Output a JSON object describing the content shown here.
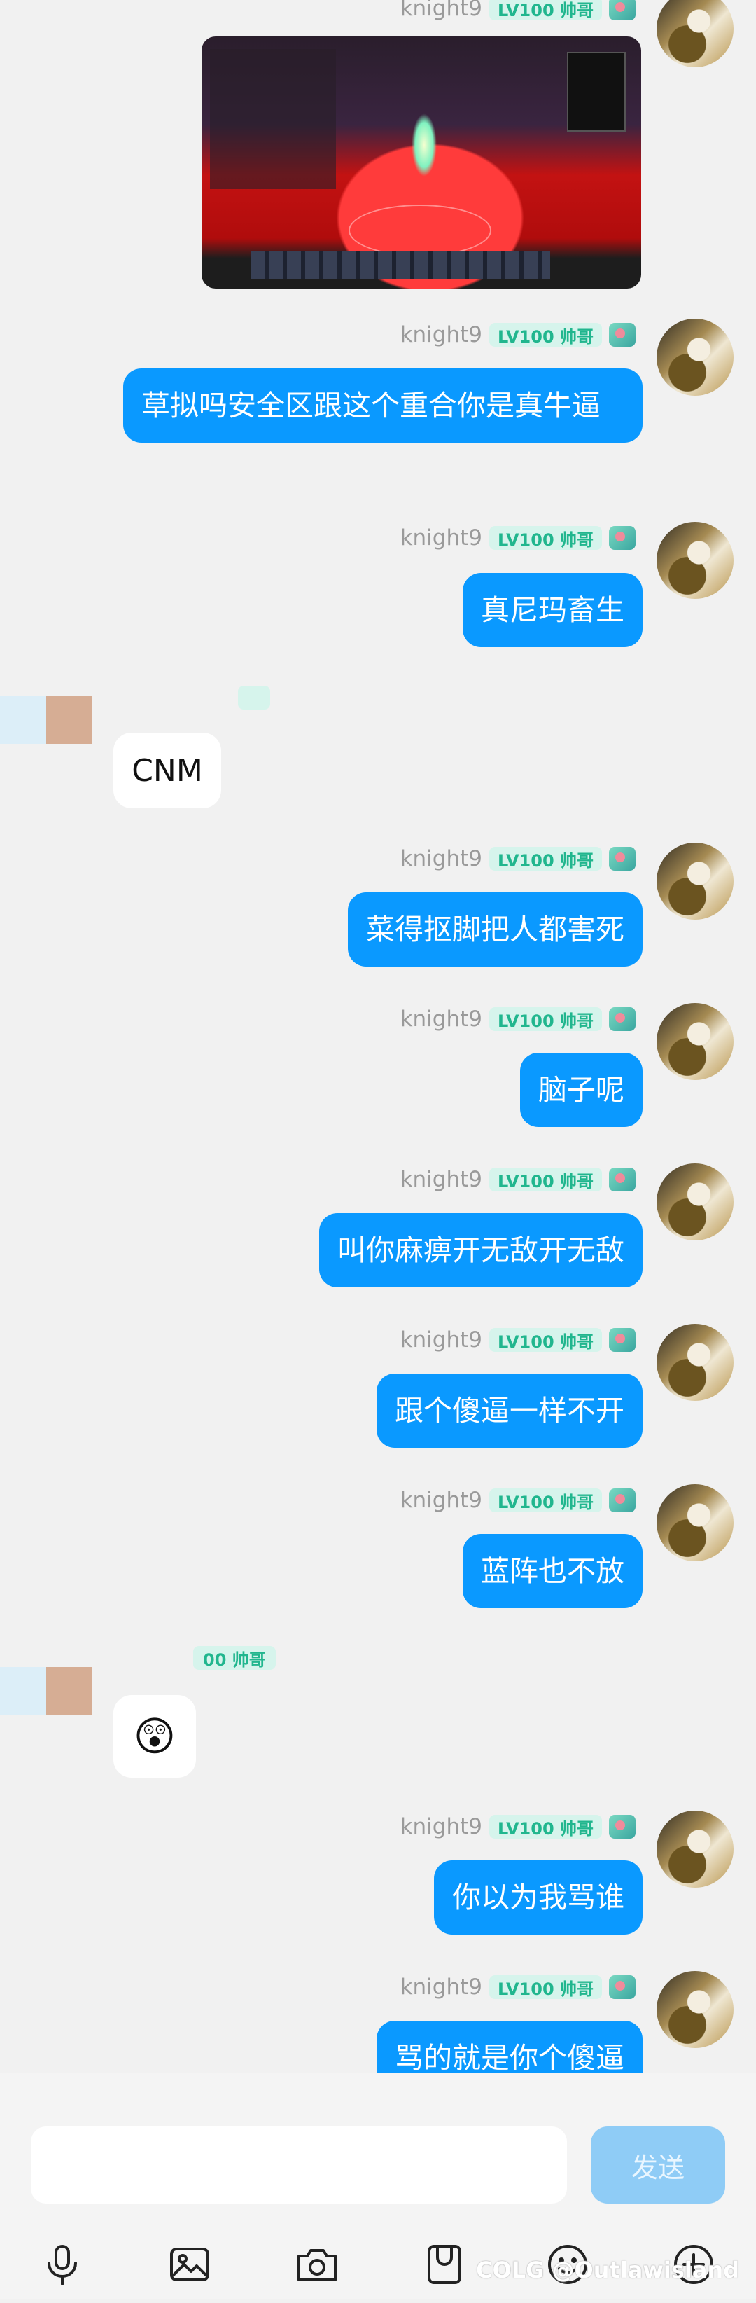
{
  "sender": {
    "name": "knight9",
    "badge": "LV100 帅哥"
  },
  "messages": [
    {
      "side": "right",
      "type": "image"
    },
    {
      "side": "right",
      "text": "草拟吗安全区跟这个重合你是真牛逼"
    },
    {
      "side": "right",
      "text": "真尼玛畜生"
    },
    {
      "side": "left",
      "text": "CNM"
    },
    {
      "side": "right",
      "text": "菜得抠脚把人都害死"
    },
    {
      "side": "right",
      "text": "脑子呢"
    },
    {
      "side": "right",
      "text": "叫你麻痹开无敌开无敌"
    },
    {
      "side": "right",
      "text": "跟个傻逼一样不开"
    },
    {
      "side": "right",
      "text": "蓝阵也不放"
    },
    {
      "side": "left",
      "type": "emoji",
      "emoji": "😲",
      "badge_partial": "00 帅哥"
    },
    {
      "side": "right",
      "text": "你以为我骂谁"
    },
    {
      "side": "right",
      "text": "骂的就是你个傻逼"
    }
  ],
  "input": {
    "placeholder": "",
    "send_label": "发送"
  },
  "toolbar": [
    "microphone-icon",
    "image-icon",
    "camera-icon",
    "file-icon",
    "emoji-icon",
    "plus-icon"
  ],
  "watermark": "COLG @Outlawisland",
  "colors": {
    "bubble_right": "#0a99ff",
    "bubble_left": "#ffffff",
    "send_button": "#8fccf6",
    "badge_text": "#21b68e"
  }
}
